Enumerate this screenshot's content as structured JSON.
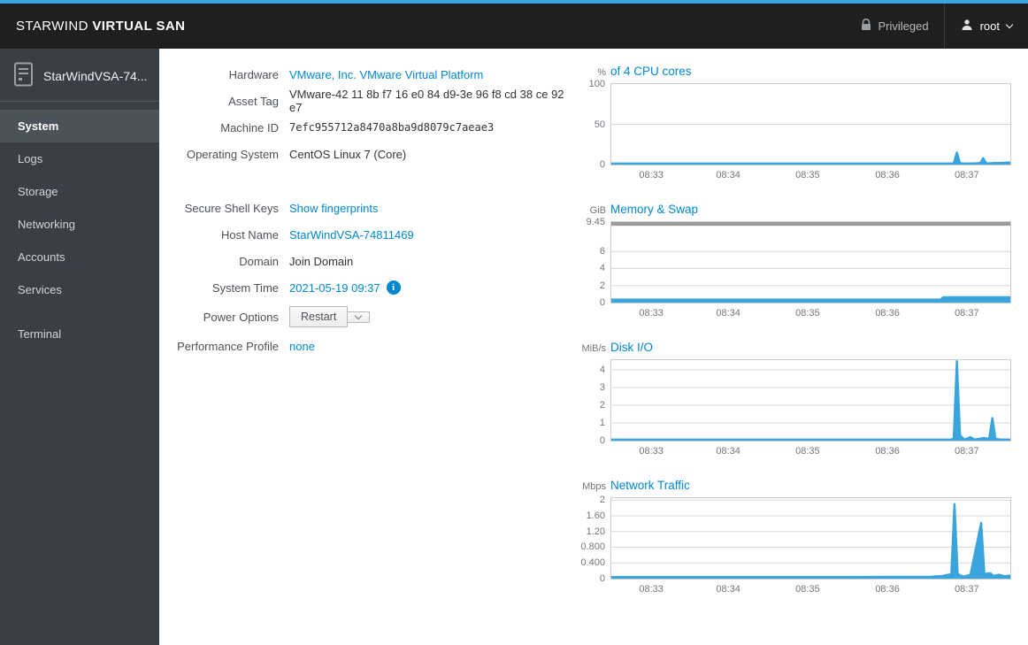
{
  "topbar": {
    "brand_prefix": "STARWIND",
    "brand_bold": "VIRTUAL SAN",
    "privileged_label": "Privileged",
    "user_label": "root"
  },
  "sidebar": {
    "host_label": "StarWindVSA-74...",
    "items": [
      {
        "label": "System",
        "selected": true
      },
      {
        "label": "Logs"
      },
      {
        "label": "Storage"
      },
      {
        "label": "Networking"
      },
      {
        "label": "Accounts"
      },
      {
        "label": "Services"
      },
      {
        "label": "Terminal",
        "gap": true
      }
    ]
  },
  "system": {
    "rows": [
      {
        "kind": "link",
        "name": "hardware",
        "label": "Hardware",
        "value": "VMware, Inc. VMware Virtual Platform"
      },
      {
        "kind": "text",
        "name": "asset-tag",
        "label": "Asset Tag",
        "value": "VMware-42 11 8b f7 16 e0 84 d9-3e 96 f8 cd 38 ce 92 e7"
      },
      {
        "kind": "mono",
        "name": "machine-id",
        "label": "Machine ID",
        "value": "7efc955712a8470a8ba9d8079c7aeae3"
      },
      {
        "kind": "text",
        "name": "operating-system",
        "label": "Operating System",
        "value": "CentOS Linux 7 (Core)"
      },
      {
        "kind": "spacer"
      },
      {
        "kind": "link",
        "name": "secure-shell-keys",
        "label": "Secure Shell Keys",
        "value": "Show fingerprints"
      },
      {
        "kind": "link",
        "name": "host-name",
        "label": "Host Name",
        "value": "StarWindVSA-74811469"
      },
      {
        "kind": "action",
        "name": "domain",
        "label": "Domain",
        "value": "Join Domain"
      },
      {
        "kind": "time",
        "name": "system-time",
        "label": "System Time",
        "value": "2021-05-19 09:37"
      },
      {
        "kind": "power",
        "name": "power-options",
        "label": "Power Options",
        "value": "Restart"
      },
      {
        "kind": "link",
        "name": "performance-profile",
        "label": "Performance Profile",
        "value": "none"
      }
    ]
  },
  "colors": {
    "accent_blue": "#39a5dc",
    "link_blue": "#0088ce",
    "chart_line": "#39a5dc",
    "memory_total_band": "#9b9b9b",
    "sidebar_bg": "#393f45",
    "topbar_bg": "#201f1f"
  },
  "chart_data": [
    {
      "id": "cpu",
      "type": "area",
      "unit": "%",
      "title": "of 4 CPU cores",
      "y_max": 100,
      "y_ticks": [
        {
          "value": 100,
          "label": "100"
        },
        {
          "value": 50,
          "label": "50"
        },
        {
          "value": 0,
          "label": "0"
        }
      ],
      "x_ticks": [
        {
          "pos": 0.1,
          "label": "08:33"
        },
        {
          "pos": 0.293,
          "label": "08:34"
        },
        {
          "pos": 0.492,
          "label": "08:35"
        },
        {
          "pos": 0.692,
          "label": "08:36"
        },
        {
          "pos": 0.891,
          "label": "08:37"
        }
      ],
      "points": [
        [
          0,
          1
        ],
        [
          0.2,
          1
        ],
        [
          0.4,
          1
        ],
        [
          0.6,
          1
        ],
        [
          0.75,
          1
        ],
        [
          0.82,
          1
        ],
        [
          0.85,
          1
        ],
        [
          0.858,
          1.3
        ],
        [
          0.866,
          15
        ],
        [
          0.874,
          1.6
        ],
        [
          0.885,
          1
        ],
        [
          0.9,
          1.3
        ],
        [
          0.915,
          1.5
        ],
        [
          0.925,
          2
        ],
        [
          0.932,
          8
        ],
        [
          0.94,
          1.6
        ],
        [
          0.95,
          1.5
        ],
        [
          0.96,
          2
        ],
        [
          0.975,
          2
        ],
        [
          0.99,
          2.4
        ],
        [
          1,
          2.5
        ]
      ]
    },
    {
      "id": "memory",
      "type": "area",
      "unit": "GiB",
      "title": "Memory & Swap",
      "y_max": 9.45,
      "band": {
        "from": 9.02,
        "to": 9.45
      },
      "y_ticks": [
        {
          "value": 9.45,
          "label": "9.45"
        },
        {
          "value": 6,
          "label": "6"
        },
        {
          "value": 4,
          "label": "4"
        },
        {
          "value": 2,
          "label": "2"
        },
        {
          "value": 0,
          "label": "0"
        }
      ],
      "x_ticks": [
        {
          "pos": 0.1,
          "label": "08:33"
        },
        {
          "pos": 0.293,
          "label": "08:34"
        },
        {
          "pos": 0.492,
          "label": "08:35"
        },
        {
          "pos": 0.692,
          "label": "08:36"
        },
        {
          "pos": 0.891,
          "label": "08:37"
        }
      ],
      "points": [
        [
          0,
          0.35
        ],
        [
          0.4,
          0.35
        ],
        [
          0.7,
          0.35
        ],
        [
          0.825,
          0.35
        ],
        [
          0.832,
          0.62
        ],
        [
          0.9,
          0.62
        ],
        [
          1,
          0.62
        ]
      ]
    },
    {
      "id": "disk",
      "type": "area",
      "unit": "MiB/s",
      "title": "Disk I/O",
      "y_max": 4.55,
      "y_ticks": [
        {
          "value": 4,
          "label": "4"
        },
        {
          "value": 3,
          "label": "3"
        },
        {
          "value": 2,
          "label": "2"
        },
        {
          "value": 1,
          "label": "1"
        },
        {
          "value": 0,
          "label": "0"
        }
      ],
      "x_ticks": [
        {
          "pos": 0.1,
          "label": "08:33"
        },
        {
          "pos": 0.293,
          "label": "08:34"
        },
        {
          "pos": 0.492,
          "label": "08:35"
        },
        {
          "pos": 0.692,
          "label": "08:36"
        },
        {
          "pos": 0.891,
          "label": "08:37"
        }
      ],
      "points": [
        [
          0,
          0.05
        ],
        [
          0.3,
          0.05
        ],
        [
          0.6,
          0.05
        ],
        [
          0.82,
          0.05
        ],
        [
          0.85,
          0.06
        ],
        [
          0.858,
          0.1
        ],
        [
          0.866,
          4.5
        ],
        [
          0.874,
          0.3
        ],
        [
          0.885,
          0.05
        ],
        [
          0.9,
          0.2
        ],
        [
          0.91,
          0.05
        ],
        [
          0.934,
          0.15
        ],
        [
          0.947,
          0.1
        ],
        [
          0.955,
          1.28
        ],
        [
          0.963,
          0.1
        ],
        [
          0.975,
          0.05
        ],
        [
          1,
          0.05
        ]
      ]
    },
    {
      "id": "network",
      "type": "area",
      "unit": "Mbps",
      "title": "Network Traffic",
      "y_max": 2.05,
      "y_ticks": [
        {
          "value": 2,
          "label": "2"
        },
        {
          "value": 1.6,
          "label": "1.60"
        },
        {
          "value": 1.2,
          "label": "1.20"
        },
        {
          "value": 0.8,
          "label": "0.800"
        },
        {
          "value": 0.4,
          "label": "0.400"
        },
        {
          "value": 0,
          "label": "0"
        }
      ],
      "x_ticks": [
        {
          "pos": 0.1,
          "label": "08:33"
        },
        {
          "pos": 0.293,
          "label": "08:34"
        },
        {
          "pos": 0.492,
          "label": "08:35"
        },
        {
          "pos": 0.692,
          "label": "08:36"
        },
        {
          "pos": 0.891,
          "label": "08:37"
        }
      ],
      "points": [
        [
          0,
          0.04
        ],
        [
          0.3,
          0.04
        ],
        [
          0.6,
          0.04
        ],
        [
          0.8,
          0.05
        ],
        [
          0.83,
          0.07
        ],
        [
          0.845,
          0.1
        ],
        [
          0.852,
          0.12
        ],
        [
          0.86,
          1.9
        ],
        [
          0.868,
          0.12
        ],
        [
          0.882,
          0.05
        ],
        [
          0.9,
          0.1
        ],
        [
          0.927,
          1.42
        ],
        [
          0.935,
          0.12
        ],
        [
          0.95,
          0.14
        ],
        [
          0.958,
          0.07
        ],
        [
          0.972,
          0.1
        ],
        [
          0.985,
          0.06
        ],
        [
          1,
          0.08
        ]
      ]
    }
  ]
}
